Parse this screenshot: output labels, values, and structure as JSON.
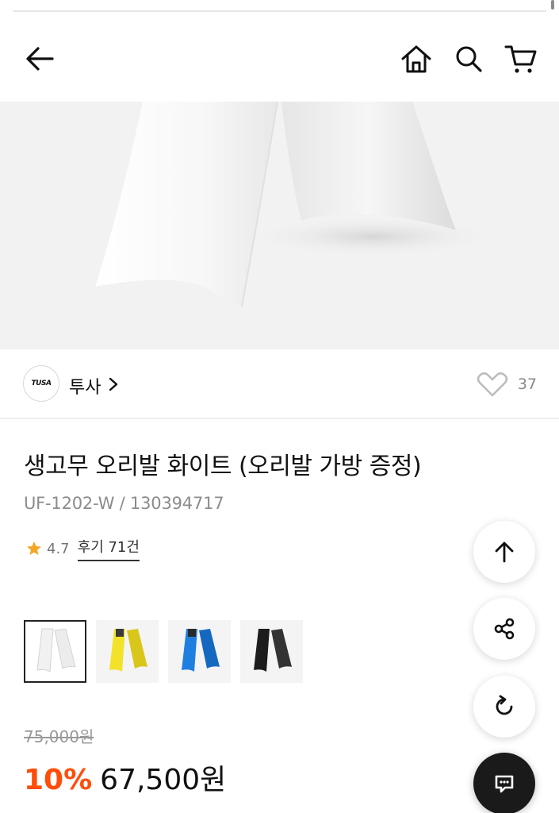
{
  "header": {
    "back_icon": "arrow-left-icon",
    "icons": [
      "home-icon",
      "search-icon",
      "cart-icon"
    ]
  },
  "brand": {
    "logo_text": "TUSA",
    "name": "투사",
    "wishlist_count": "37"
  },
  "product": {
    "title": "생고무 오리발 화이트 (오리발 가방 증정)",
    "model": "UF-1202-W / 130394717",
    "rating": "4.7",
    "reviews": "후기 71건"
  },
  "variants": [
    {
      "color_name": "white",
      "color": "#f2f2f2",
      "selected": true
    },
    {
      "color_name": "yellow",
      "color": "#f2e22a",
      "selected": false
    },
    {
      "color_name": "blue",
      "color": "#1f7fe0",
      "selected": false
    },
    {
      "color_name": "black",
      "color": "#1c1c1c",
      "selected": false
    }
  ],
  "price": {
    "original": "75,000원",
    "discount": "10%",
    "sale": "67,500원"
  },
  "floating": {
    "icons": [
      "arrow-up-icon",
      "share-icon",
      "refresh-icon",
      "chat-icon"
    ]
  },
  "colors": {
    "accent": "#ff4d0a",
    "star": "#f5a623"
  }
}
